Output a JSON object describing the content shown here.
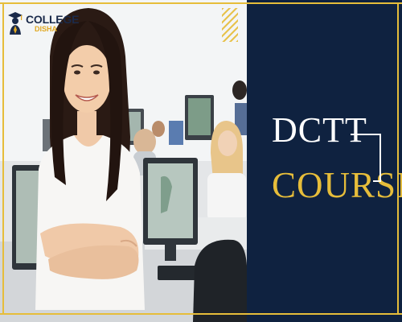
{
  "brand": {
    "line_1": "COLLEGE",
    "line_2": "DISHA",
    "icon": "graduate-cap-logo-icon"
  },
  "headline": {
    "line_1": "DCTT",
    "line_2": "COURSE"
  },
  "colors": {
    "navy": "#0f2240",
    "gold": "#e6bd3a",
    "white": "#ffffff"
  }
}
